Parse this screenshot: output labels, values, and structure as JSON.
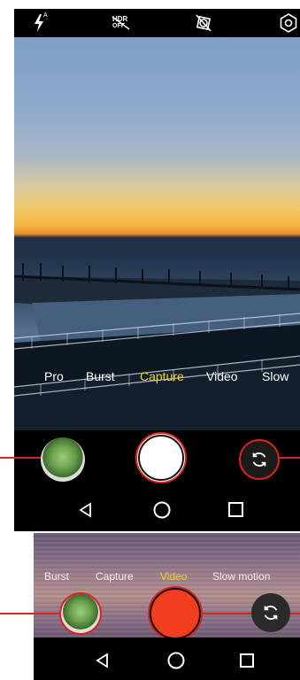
{
  "colors": {
    "accent_mode": "#f3d21f",
    "annotation_red": "#d22222",
    "record_red": "#f23d1f"
  },
  "top_screen": {
    "top_bar": {
      "icons": [
        "flash-auto-icon",
        "hdr-off-icon",
        "ai-scene-off-icon",
        "settings-icon"
      ],
      "hdr_label_top": "HDR",
      "hdr_label_bottom": "OFF",
      "flash_suffix": "A"
    },
    "modes": [
      {
        "label": "Pro",
        "active": false
      },
      {
        "label": "Burst",
        "active": false
      },
      {
        "label": "Capture",
        "active": true
      },
      {
        "label": "Video",
        "active": false
      },
      {
        "label": "Slow",
        "active": false
      }
    ]
  },
  "bottom_screen": {
    "modes": [
      {
        "label": "Burst",
        "active": false
      },
      {
        "label": "Capture",
        "active": false
      },
      {
        "label": "Video",
        "active": true
      },
      {
        "label": "Slow motion",
        "active": false
      }
    ]
  },
  "nav_bar": {
    "icons": [
      "back-icon",
      "home-icon",
      "recents-icon"
    ]
  }
}
